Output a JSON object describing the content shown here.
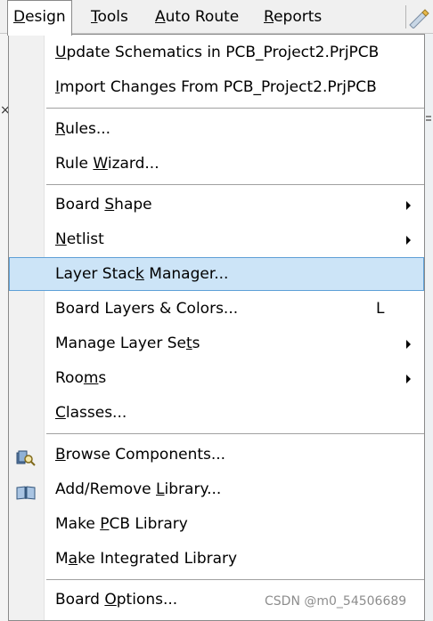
{
  "menubar": {
    "items": [
      {
        "pre": "",
        "u": "D",
        "post": "esign"
      },
      {
        "pre": "",
        "u": "T",
        "post": "ools"
      },
      {
        "pre": "",
        "u": "A",
        "post": "uto Route"
      },
      {
        "pre": "",
        "u": "R",
        "post": "eports"
      }
    ]
  },
  "dropdown": {
    "items": [
      {
        "pre": "",
        "u": "U",
        "post": "pdate Schematics in PCB_Project2.PrjPCB"
      },
      {
        "pre": "",
        "u": "I",
        "post": "mport Changes From PCB_Project2.PrjPCB"
      },
      {
        "pre": "",
        "u": "R",
        "post": "ules..."
      },
      {
        "pre": "Rule ",
        "u": "W",
        "post": "izard..."
      },
      {
        "pre": "Board ",
        "u": "S",
        "post": "hape"
      },
      {
        "pre": "",
        "u": "N",
        "post": "etlist"
      },
      {
        "pre": "Layer Stac",
        "u": "k",
        "post": " Manager..."
      },
      {
        "pre": "Board Layers & Colors...",
        "u": "",
        "post": "",
        "shortcut": "L"
      },
      {
        "pre": "Manage Layer Se",
        "u": "t",
        "post": "s"
      },
      {
        "pre": "Roo",
        "u": "m",
        "post": "s"
      },
      {
        "pre": "",
        "u": "C",
        "post": "lasses..."
      },
      {
        "pre": "",
        "u": "B",
        "post": "rowse Components..."
      },
      {
        "pre": "Add/Remove ",
        "u": "L",
        "post": "ibrary..."
      },
      {
        "pre": "Make ",
        "u": "P",
        "post": "CB Library"
      },
      {
        "pre": "M",
        "u": "a",
        "post": "ke Integrated Library"
      },
      {
        "pre": "Board ",
        "u": "O",
        "post": "ptions..."
      }
    ]
  },
  "icons": {
    "browse": "browse-components-icon",
    "library": "library-book-icon"
  },
  "colors": {
    "highlight": "#cce4f7",
    "highlight_border": "#5ea0d7"
  },
  "watermark": "CSDN @m0_54506689"
}
